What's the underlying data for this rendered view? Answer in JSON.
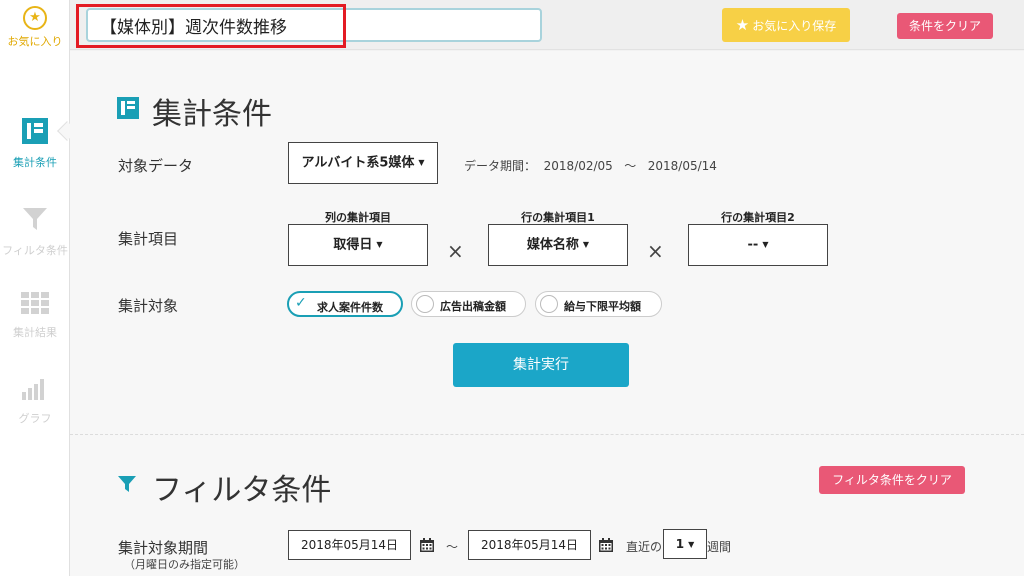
{
  "sidebar": {
    "favorite_label": "お気に入り",
    "items": [
      {
        "label": "集計条件",
        "active": true
      },
      {
        "label": "フィルタ条件",
        "active": false
      },
      {
        "label": "集計結果",
        "active": false
      },
      {
        "label": "グラフ",
        "active": false
      }
    ]
  },
  "topbar": {
    "title_value": "【媒体別】週次件数推移",
    "favorite_save_label": "お気に入り保存",
    "clear_conditions_label": "条件をクリア"
  },
  "aggregation": {
    "section_title": "集計条件",
    "target_data_label": "対象データ",
    "target_data_value": "アルバイト系5媒体",
    "period_label": "データ期間：",
    "period_start": "2018/02/05",
    "period_tilde": "～",
    "period_end": "2018/05/14",
    "items_label": "集計項目",
    "col_item_head": "列の集計項目",
    "col_item_value": "取得日",
    "row_item1_head": "行の集計項目1",
    "row_item1_value": "媒体名称",
    "row_item2_head": "行の集計項目2",
    "row_item2_value": "--",
    "times": "×",
    "target_label": "集計対象",
    "targets": [
      {
        "label": "求人案件件数",
        "checked": true
      },
      {
        "label": "広告出稿金額",
        "checked": false
      },
      {
        "label": "給与下限平均額",
        "checked": false
      }
    ],
    "run_label": "集計実行"
  },
  "filter": {
    "section_title": "フィルタ条件",
    "clear_label": "フィルタ条件をクリア",
    "period_label": "集計対象期間",
    "period_note": "（月曜日のみ指定可能）",
    "date_from": "2018年05月14日",
    "tilde": "～",
    "date_to": "2018年05月14日",
    "recent_prefix": "直近の",
    "recent_value": "1",
    "recent_suffix": "週間"
  },
  "colors": {
    "accent": "#1a9fb5",
    "run_button": "#1ba6c8",
    "clear_button": "#e95876",
    "favorite_button": "#f7d046",
    "highlight": "#e31b23"
  }
}
